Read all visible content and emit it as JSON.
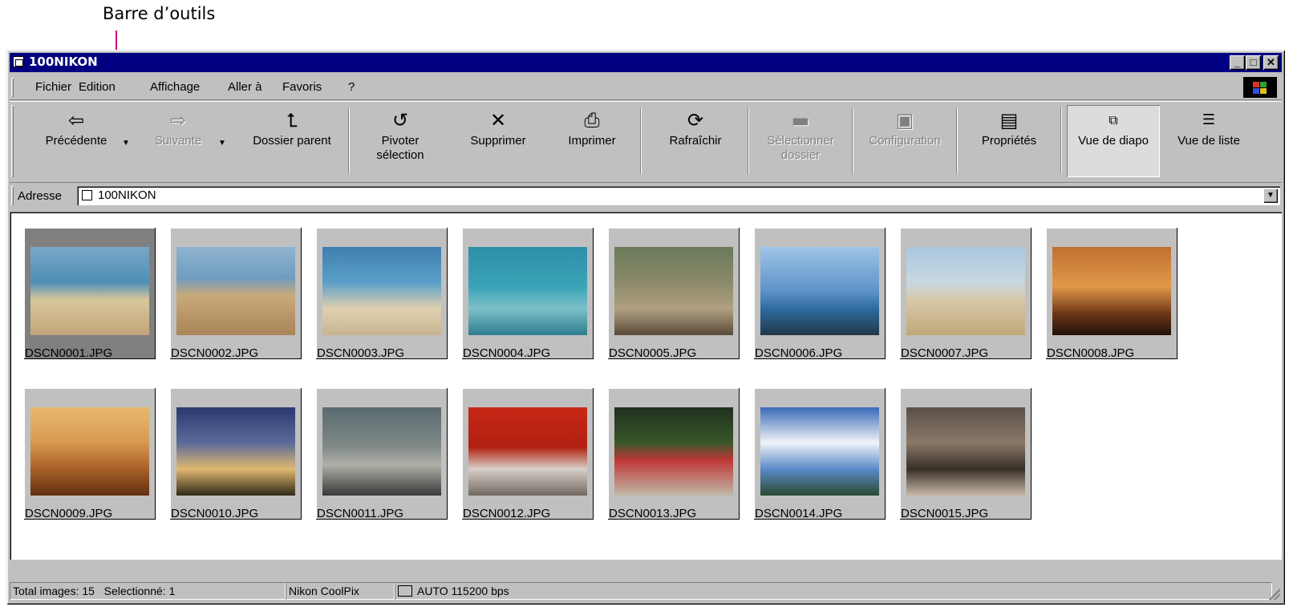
{
  "annotation": {
    "label": "Barre d’outils"
  },
  "window": {
    "title": "100NIKON",
    "controls": {
      "minimize": "_",
      "maximize": "□",
      "close": "✕"
    }
  },
  "menu": [
    "Fichier",
    "Edition",
    "Affichage",
    "Aller à",
    "Favoris",
    "?"
  ],
  "toolbar": {
    "back": {
      "label": "Précédente",
      "icon": "arrow-left-icon"
    },
    "forward": {
      "label": "Suivante",
      "icon": "arrow-right-icon"
    },
    "up": {
      "label": "Dossier parent",
      "icon": "folder-up-icon"
    },
    "rotate": {
      "label1": "Pivoter",
      "label2": "sélection",
      "icon": "rotate-icon"
    },
    "delete": {
      "label": "Supprimer",
      "icon": "x-icon"
    },
    "print": {
      "label": "Imprimer",
      "icon": "printer-icon"
    },
    "refresh": {
      "label": "Rafraîchir",
      "icon": "refresh-icon"
    },
    "select_folder": {
      "label1": "Sélectionner",
      "label2": "dossier",
      "icon": "folder-icon"
    },
    "config": {
      "label": "Configuration",
      "icon": "camera-icon"
    },
    "properties": {
      "label": "Propriétés",
      "icon": "properties-icon"
    },
    "slide_view": {
      "label": "Vue de diapo",
      "icon": "slides-icon"
    },
    "list_view": {
      "label": "Vue de liste",
      "icon": "list-icon"
    }
  },
  "address": {
    "label": "Adresse",
    "value": "100NIKON"
  },
  "images": [
    {
      "name": "DSCN0001.JPG",
      "selected": true
    },
    {
      "name": "DSCN0002.JPG"
    },
    {
      "name": "DSCN0003.JPG"
    },
    {
      "name": "DSCN0004.JPG"
    },
    {
      "name": "DSCN0005.JPG"
    },
    {
      "name": "DSCN0006.JPG"
    },
    {
      "name": "DSCN0007.JPG"
    },
    {
      "name": "DSCN0008.JPG"
    },
    {
      "name": "DSCN0009.JPG"
    },
    {
      "name": "DSCN0010.JPG"
    },
    {
      "name": "DSCN0011.JPG"
    },
    {
      "name": "DSCN0012.JPG"
    },
    {
      "name": "DSCN0013.JPG"
    },
    {
      "name": "DSCN0014.JPG"
    },
    {
      "name": "DSCN0015.JPG"
    }
  ],
  "status": {
    "total": "Total images: 15",
    "selected": "Selectionné: 1",
    "camera": "Nikon CoolPix",
    "connection": "AUTO  115200 bps"
  },
  "colors": {
    "titlebar": "#000080",
    "chrome": "#c0c0c0",
    "annotation_line": "#d4007a"
  }
}
